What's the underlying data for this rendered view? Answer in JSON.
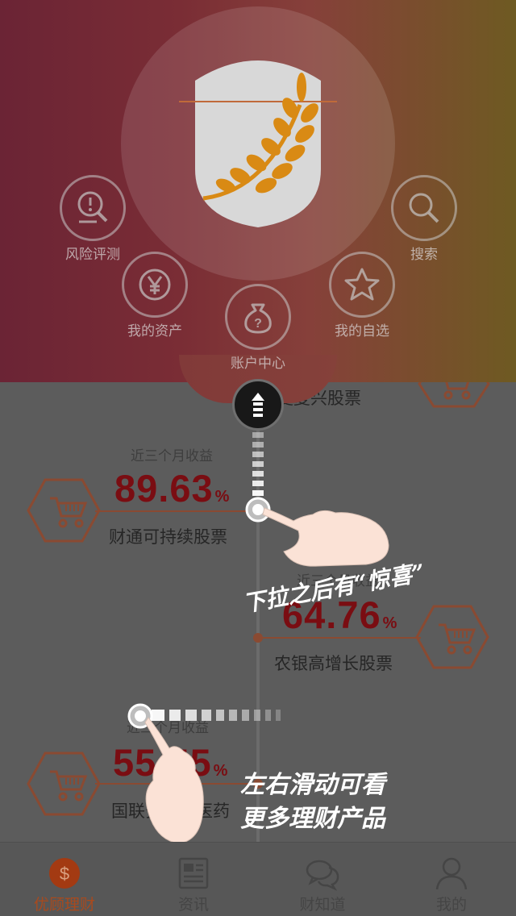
{
  "menu": {
    "items": [
      {
        "label": "风险评测",
        "icon": "risk-assessment-icon"
      },
      {
        "label": "搜索",
        "icon": "search-icon"
      },
      {
        "label": "我的资产",
        "icon": "yen-icon"
      },
      {
        "label": "我的自选",
        "icon": "star-icon"
      },
      {
        "label": "账户中心",
        "icon": "money-bag-icon"
      }
    ],
    "logo": "wheat-shield-logo"
  },
  "products": [
    {
      "title": "华夏复兴股票"
    },
    {
      "caption": "近三个月收益",
      "value": "89.63",
      "unit": "%",
      "title": "财通可持续股票"
    },
    {
      "caption": "近三个月收益",
      "value": "64.76",
      "unit": "%",
      "title": "农银高增长股票"
    },
    {
      "caption": "近三个月收益",
      "value": "55.55",
      "unit": "%",
      "title": "国联安优选医药"
    }
  ],
  "hints": {
    "pull_down": "下拉之后有“惊喜”",
    "swipe_line1": "左右滑动可看",
    "swipe_line2": "更多理财产品"
  },
  "tabbar": {
    "tabs": [
      {
        "label": "优顾理财",
        "icon": "dollar-icon",
        "active": true
      },
      {
        "label": "资讯",
        "icon": "newspaper-icon",
        "active": false
      },
      {
        "label": "财知道",
        "icon": "chat-bubbles-icon",
        "active": false
      },
      {
        "label": "我的",
        "icon": "person-icon",
        "active": false
      }
    ]
  },
  "colors": {
    "accent": "#a84a1e",
    "value_red": "#7a0d12",
    "icon_orange": "#8a4a32",
    "wheat": "#d98a14"
  }
}
